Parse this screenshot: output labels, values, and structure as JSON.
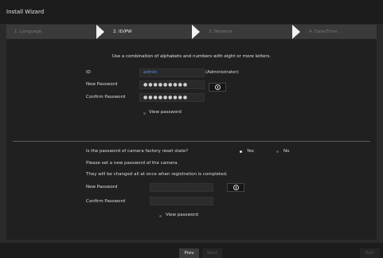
{
  "window": {
    "title": "Install Wizard"
  },
  "steps": [
    {
      "label": "1. Language",
      "state": "done"
    },
    {
      "label": "2. ID/PW",
      "state": "active"
    },
    {
      "label": "3. Network",
      "state": "pending"
    },
    {
      "label": "4. Date/Time",
      "state": "pending"
    }
  ],
  "recorder": {
    "instruction": "Use a combination of alphabets and numbers with eight or more letters.",
    "id_label": "ID",
    "id_value": "admin",
    "id_note": "(Administrator)",
    "new_password_label": "New Password",
    "new_password_value": "●●●●●●●●●",
    "confirm_password_label": "Confirm Password",
    "confirm_password_value": "●●●●●●●●●",
    "view_password_label": "View password"
  },
  "camera": {
    "question": "Is the password of camera factory reset state?",
    "yes_label": "Yes",
    "no_label": "No",
    "selected": "yes",
    "set_text": "Please set a new password of the camera.",
    "note_text": "They will be changed all at once when registration is completed.",
    "new_password_label": "New Password",
    "confirm_password_label": "Confirm Password",
    "view_password_label": "View password"
  },
  "footer": {
    "prev_label": "Prev",
    "next_label": "Next",
    "exit_label": "Exit"
  },
  "colors": {
    "background": "#2a2a2a",
    "panel": "#202020",
    "id_value_text": "#5a8fd8"
  },
  "icons": {
    "info": "info-icon",
    "chevron": "chevron-right-icon"
  }
}
